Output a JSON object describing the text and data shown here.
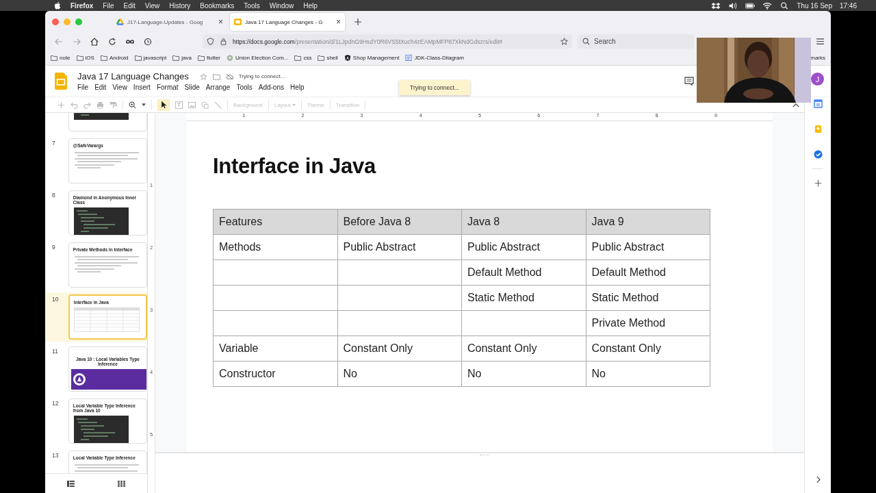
{
  "menubar": {
    "app": "Firefox",
    "items": [
      "File",
      "Edit",
      "View",
      "History",
      "Bookmarks",
      "Tools",
      "Window",
      "Help"
    ],
    "date": "Thu 16 Sep",
    "time": "17:46"
  },
  "tabs": [
    {
      "title": "J17-Language-Updates - Goog",
      "close": "×",
      "selected": false
    },
    {
      "title": "Java 17 Language Changes - G",
      "close": "×",
      "selected": true
    }
  ],
  "address": {
    "url_host": "https://docs.google.com",
    "url_path": "/presentation/d/1LJpdnG9HsdY0R6VS5tXuch4zEAMpMFP87XkNdGdszrs/edit#",
    "search_placeholder": "Search"
  },
  "bookmarks": [
    {
      "label": "note",
      "kind": "folder"
    },
    {
      "label": "iOS",
      "kind": "folder"
    },
    {
      "label": "Android",
      "kind": "folder"
    },
    {
      "label": "javascript",
      "kind": "folder"
    },
    {
      "label": "java",
      "kind": "folder"
    },
    {
      "label": "flutter",
      "kind": "folder"
    },
    {
      "label": "Union Election Com...",
      "kind": "site"
    },
    {
      "label": "css",
      "kind": "folder"
    },
    {
      "label": "shell",
      "kind": "folder"
    },
    {
      "label": "Shop Management",
      "kind": "app"
    },
    {
      "label": "JDK-Class-Diiagram",
      "kind": "doc"
    }
  ],
  "bookmarks_overflow": "marks",
  "doc": {
    "title": "Java 17 Language Changes",
    "status": "Trying to connect...",
    "menu": [
      "File",
      "Edit",
      "View",
      "Insert",
      "Format",
      "Slide",
      "Arrange",
      "Tools",
      "Add-ons",
      "Help"
    ],
    "toast": "Trying to connect...",
    "avatar": "J"
  },
  "toolbar": {
    "buttons": [
      {
        "label": "Background",
        "dropdown": false
      },
      {
        "label": "Layout",
        "dropdown": true
      },
      {
        "label": "Theme",
        "dropdown": false
      },
      {
        "label": "Transition",
        "dropdown": false
      }
    ]
  },
  "ruler": {
    "marks": [
      "1",
      "2",
      "3",
      "4",
      "5",
      "6",
      "7",
      "8",
      "9"
    ],
    "vertical_marks": [
      "1",
      "2",
      "3",
      "4",
      "5"
    ]
  },
  "slides": [
    {
      "kind": "code",
      "selected": false
    },
    {
      "number": "7",
      "title": "@SafeVarargs",
      "kind": "bullets",
      "selected": false
    },
    {
      "number": "8",
      "title": "Diamond in Anonymous Inner Class",
      "kind": "code",
      "selected": false
    },
    {
      "number": "9",
      "title": "Private Methods in Interface",
      "kind": "bullets",
      "selected": false
    },
    {
      "number": "10",
      "title": "Interface in Java",
      "kind": "table",
      "selected": true
    },
    {
      "number": "11",
      "title": "Java 10 : Local Variables Type Inference",
      "kind": "banner",
      "selected": false
    },
    {
      "number": "12",
      "title": "Local Variable Type Inference from Java 10",
      "kind": "code",
      "selected": false
    },
    {
      "number": "13",
      "title": "Local Variable Type Inference",
      "kind": "bullets",
      "selected": false
    }
  ],
  "slide": {
    "title": "Interface in Java",
    "table": {
      "columns": [
        "Features",
        "Before Java 8",
        "Java 8",
        "Java 9"
      ],
      "rows": [
        [
          "Methods",
          "Public Abstract",
          "Public Abstract",
          "Public Abstract"
        ],
        [
          "",
          "",
          "Default Method",
          "Default Method"
        ],
        [
          "",
          "",
          "Static Method",
          "Static Method"
        ],
        [
          "",
          "",
          "",
          "Private Method"
        ],
        [
          "Variable",
          "Constant Only",
          "Constant Only",
          "Constant Only"
        ],
        [
          "Constructor",
          "No",
          "No",
          "No"
        ]
      ]
    }
  }
}
